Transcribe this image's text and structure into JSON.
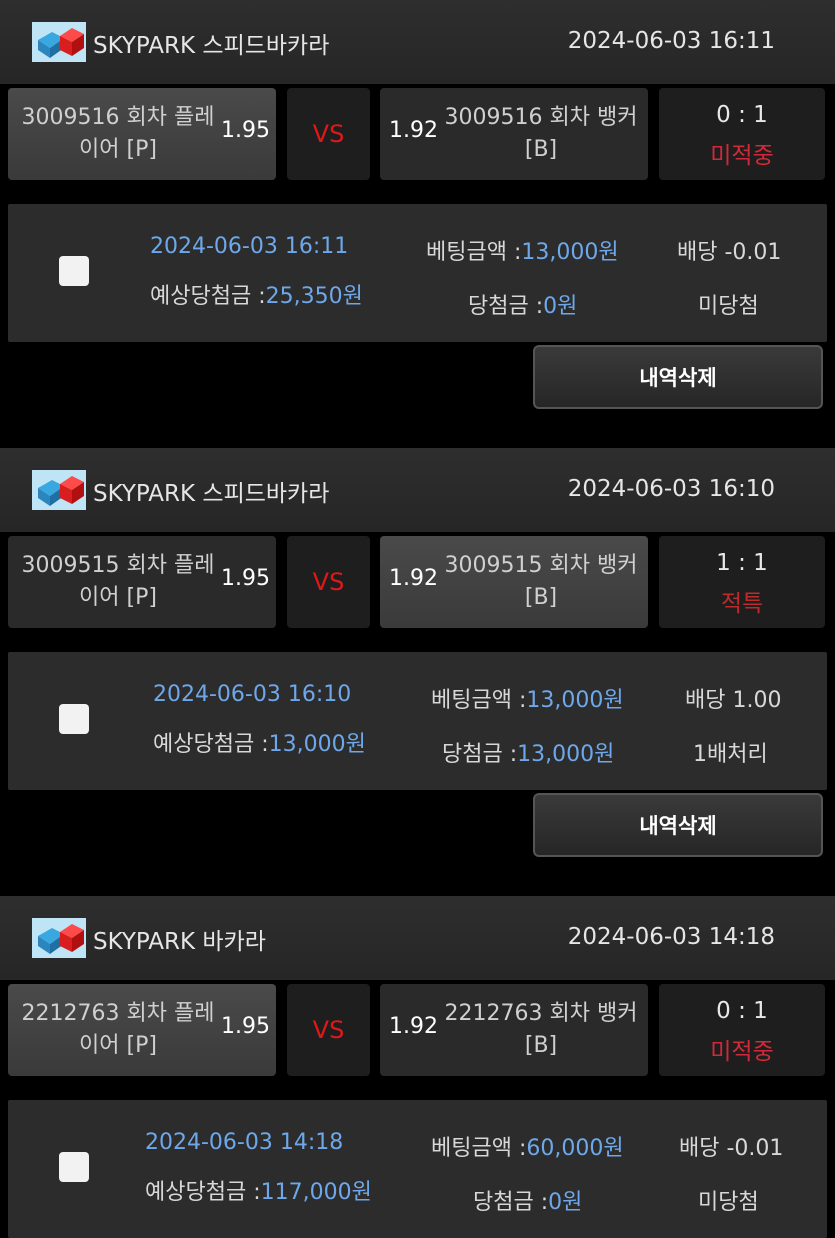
{
  "colors": {
    "accent_blue": "#6ea8ea",
    "vs_red": "#e01818",
    "status_red": "#d02a3a",
    "background": "#000000"
  },
  "cards": [
    {
      "game": "SKYPARK 스피드바카라",
      "time": "2024-06-03 16:11",
      "player_line1": "3009516 회차 플레",
      "player_line2": "이어 [P]",
      "player_odds": "1.95",
      "vs": "VS",
      "banker_odds": "1.92",
      "banker_line1": "3009516 회차 뱅커",
      "banker_line2": "[B]",
      "score": "0 : 1",
      "status": "미적중",
      "bet_time": "2024-06-03 16:11",
      "bet_label": "베팅금액 :",
      "bet_amount": "13,000원",
      "expected_label": "예상당첨금 :",
      "expected_amount": "25,350원",
      "win_label": "당첨금 :",
      "win_amount": "0원",
      "payout": "배당 -0.01",
      "result": "미당첨",
      "delete_label": "내역삭제"
    },
    {
      "game": "SKYPARK 스피드바카라",
      "time": "2024-06-03 16:10",
      "player_line1": "3009515 회차 플레",
      "player_line2": "이어 [P]",
      "player_odds": "1.95",
      "vs": "VS",
      "banker_odds": "1.92",
      "banker_line1": "3009515 회차 뱅커",
      "banker_line2": "[B]",
      "score": "1 : 1",
      "status": "적특",
      "bet_time": "2024-06-03 16:10",
      "bet_label": "베팅금액 :",
      "bet_amount": "13,000원",
      "expected_label": "예상당첨금 :",
      "expected_amount": "13,000원",
      "win_label": "당첨금 :",
      "win_amount": "13,000원",
      "payout": "배당 1.00",
      "result": "1배처리",
      "delete_label": "내역삭제"
    },
    {
      "game": "SKYPARK 바카라",
      "time": "2024-06-03 14:18",
      "player_line1": "2212763 회차 플레",
      "player_line2": "이어 [P]",
      "player_odds": "1.95",
      "vs": "VS",
      "banker_odds": "1.92",
      "banker_line1": "2212763 회차 뱅커",
      "banker_line2": "[B]",
      "score": "0 : 1",
      "status": "미적중",
      "bet_time": "2024-06-03 14:18",
      "bet_label": "베팅금액 :",
      "bet_amount": "60,000원",
      "expected_label": "예상당첨금 :",
      "expected_amount": "117,000원",
      "win_label": "당첨금 :",
      "win_amount": "0원",
      "payout": "배당 -0.01",
      "result": "미당첨"
    }
  ]
}
